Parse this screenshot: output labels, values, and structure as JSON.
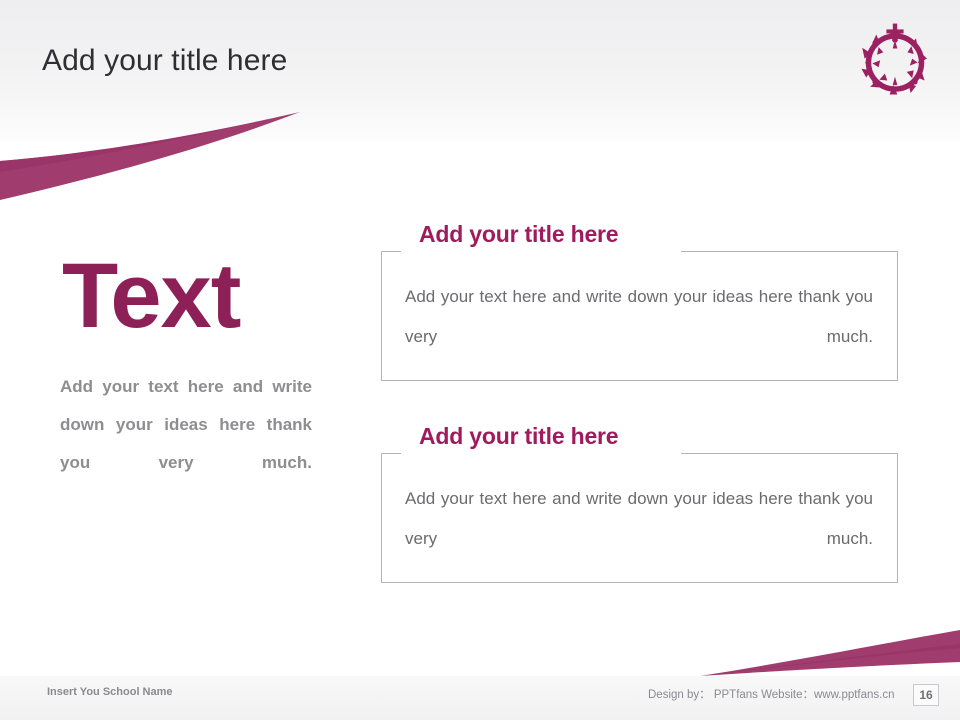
{
  "slide": {
    "page_number": "16",
    "accent_color": "#8d2157",
    "swoosh_color": "#a03c6e",
    "title_color": "#2f2f33",
    "body_color": "#6b6b70",
    "muted_color": "#8e8e92"
  },
  "header": {
    "title": "Add your title here",
    "logo_name": "crown-of-thorns-cross-logo"
  },
  "left": {
    "headline": "Text",
    "paragraph": "Add your text here and write down your ideas here thank you very much."
  },
  "cards": [
    {
      "title": "Add your title here",
      "body": "Add your text here and write down your ideas here thank you very much."
    },
    {
      "title": "Add your title here",
      "body": "Add your text here and write down your ideas here thank you very much."
    }
  ],
  "footer": {
    "school_name": "Insert You School Name",
    "credit": "Design by： PPTfans  Website：www.pptfans.cn"
  }
}
